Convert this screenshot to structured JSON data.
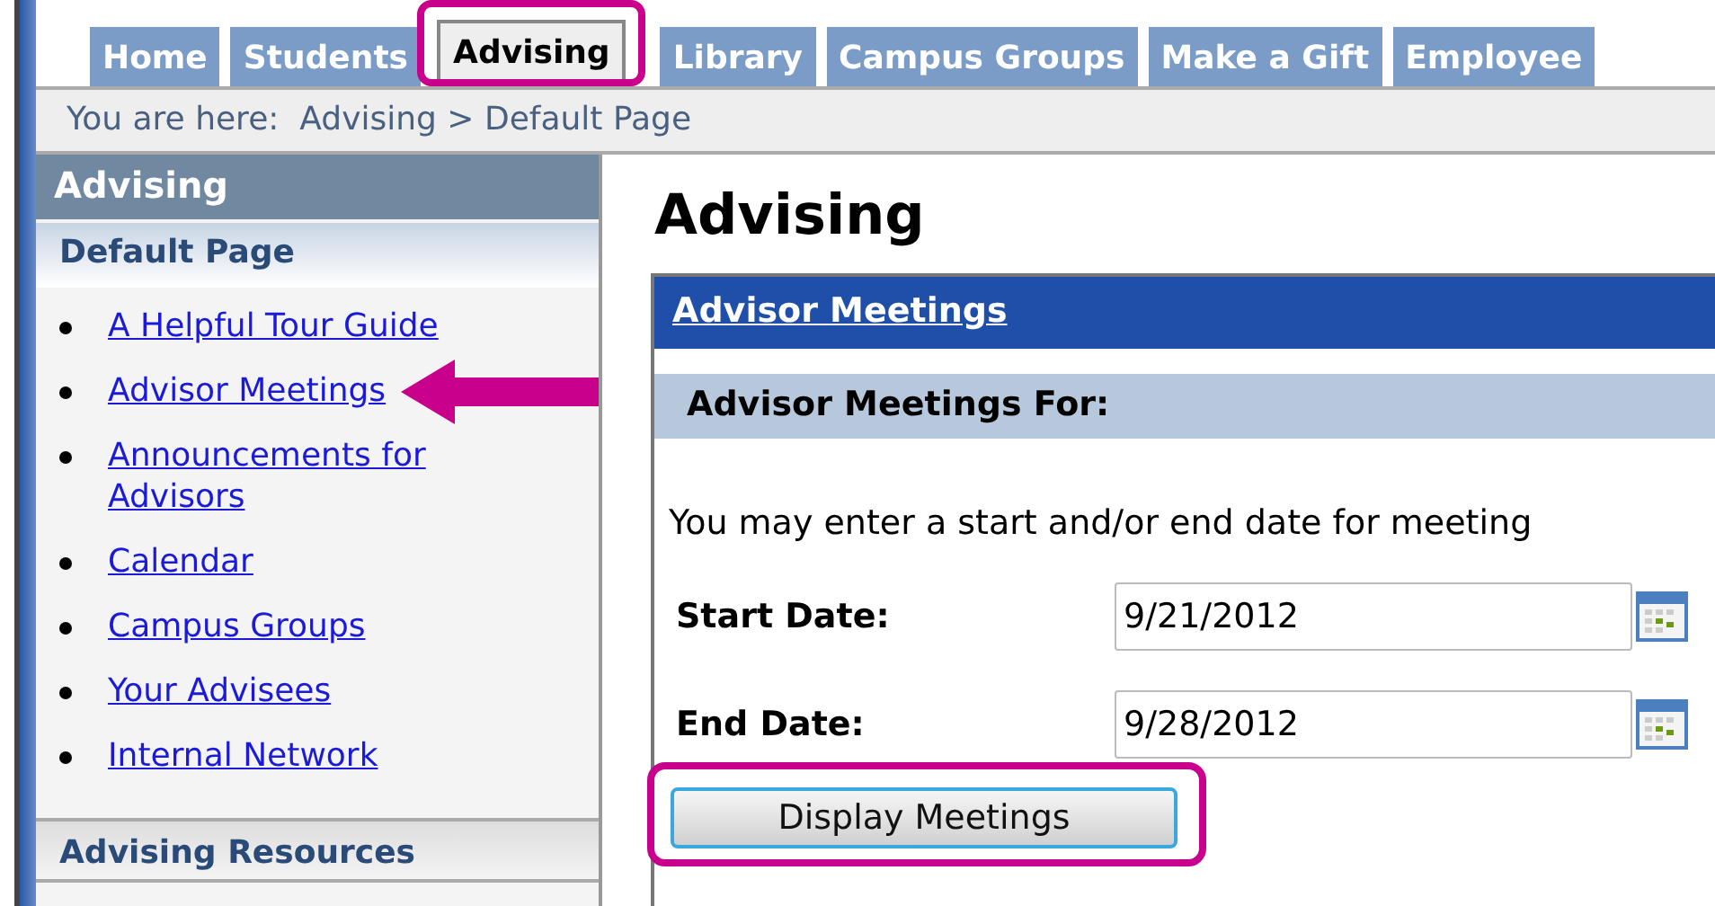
{
  "tabs": [
    {
      "label": "Home",
      "selected": false,
      "highlighted": false
    },
    {
      "label": "Students",
      "selected": false,
      "highlighted": false
    },
    {
      "label": "Advising",
      "selected": true,
      "highlighted": true
    },
    {
      "label": "Library",
      "selected": false,
      "highlighted": false
    },
    {
      "label": "Campus Groups",
      "selected": false,
      "highlighted": false
    },
    {
      "label": "Make a Gift",
      "selected": false,
      "highlighted": false
    },
    {
      "label": "Employee",
      "selected": false,
      "highlighted": false
    }
  ],
  "breadcrumb": "You are here:  Advising > Default Page",
  "sidebar": {
    "title": "Advising",
    "section": "Default Page",
    "items": [
      {
        "label": "A Helpful Tour Guide ",
        "pointed": false
      },
      {
        "label": "Advisor Meetings",
        "pointed": true
      },
      {
        "label": "Announcements for Advisors",
        "pointed": false
      },
      {
        "label": "Calendar",
        "pointed": false
      },
      {
        "label": "Campus Groups",
        "pointed": false
      },
      {
        "label": "Your Advisees ",
        "pointed": false
      },
      {
        "label": "Internal Network ",
        "pointed": false
      }
    ],
    "footer_section": "Advising Resources"
  },
  "main": {
    "heading": "Advising",
    "panel_title": "Advisor Meetings",
    "subheading": "Advisor Meetings For:",
    "intro": "You may enter a start and/or end date for meeting",
    "fields": [
      {
        "label": "Start Date:",
        "value": "9/21/2012"
      },
      {
        "label": "End Date:",
        "value": "9/28/2012"
      }
    ],
    "button": {
      "label": "Display Meetings",
      "highlighted": true
    }
  }
}
